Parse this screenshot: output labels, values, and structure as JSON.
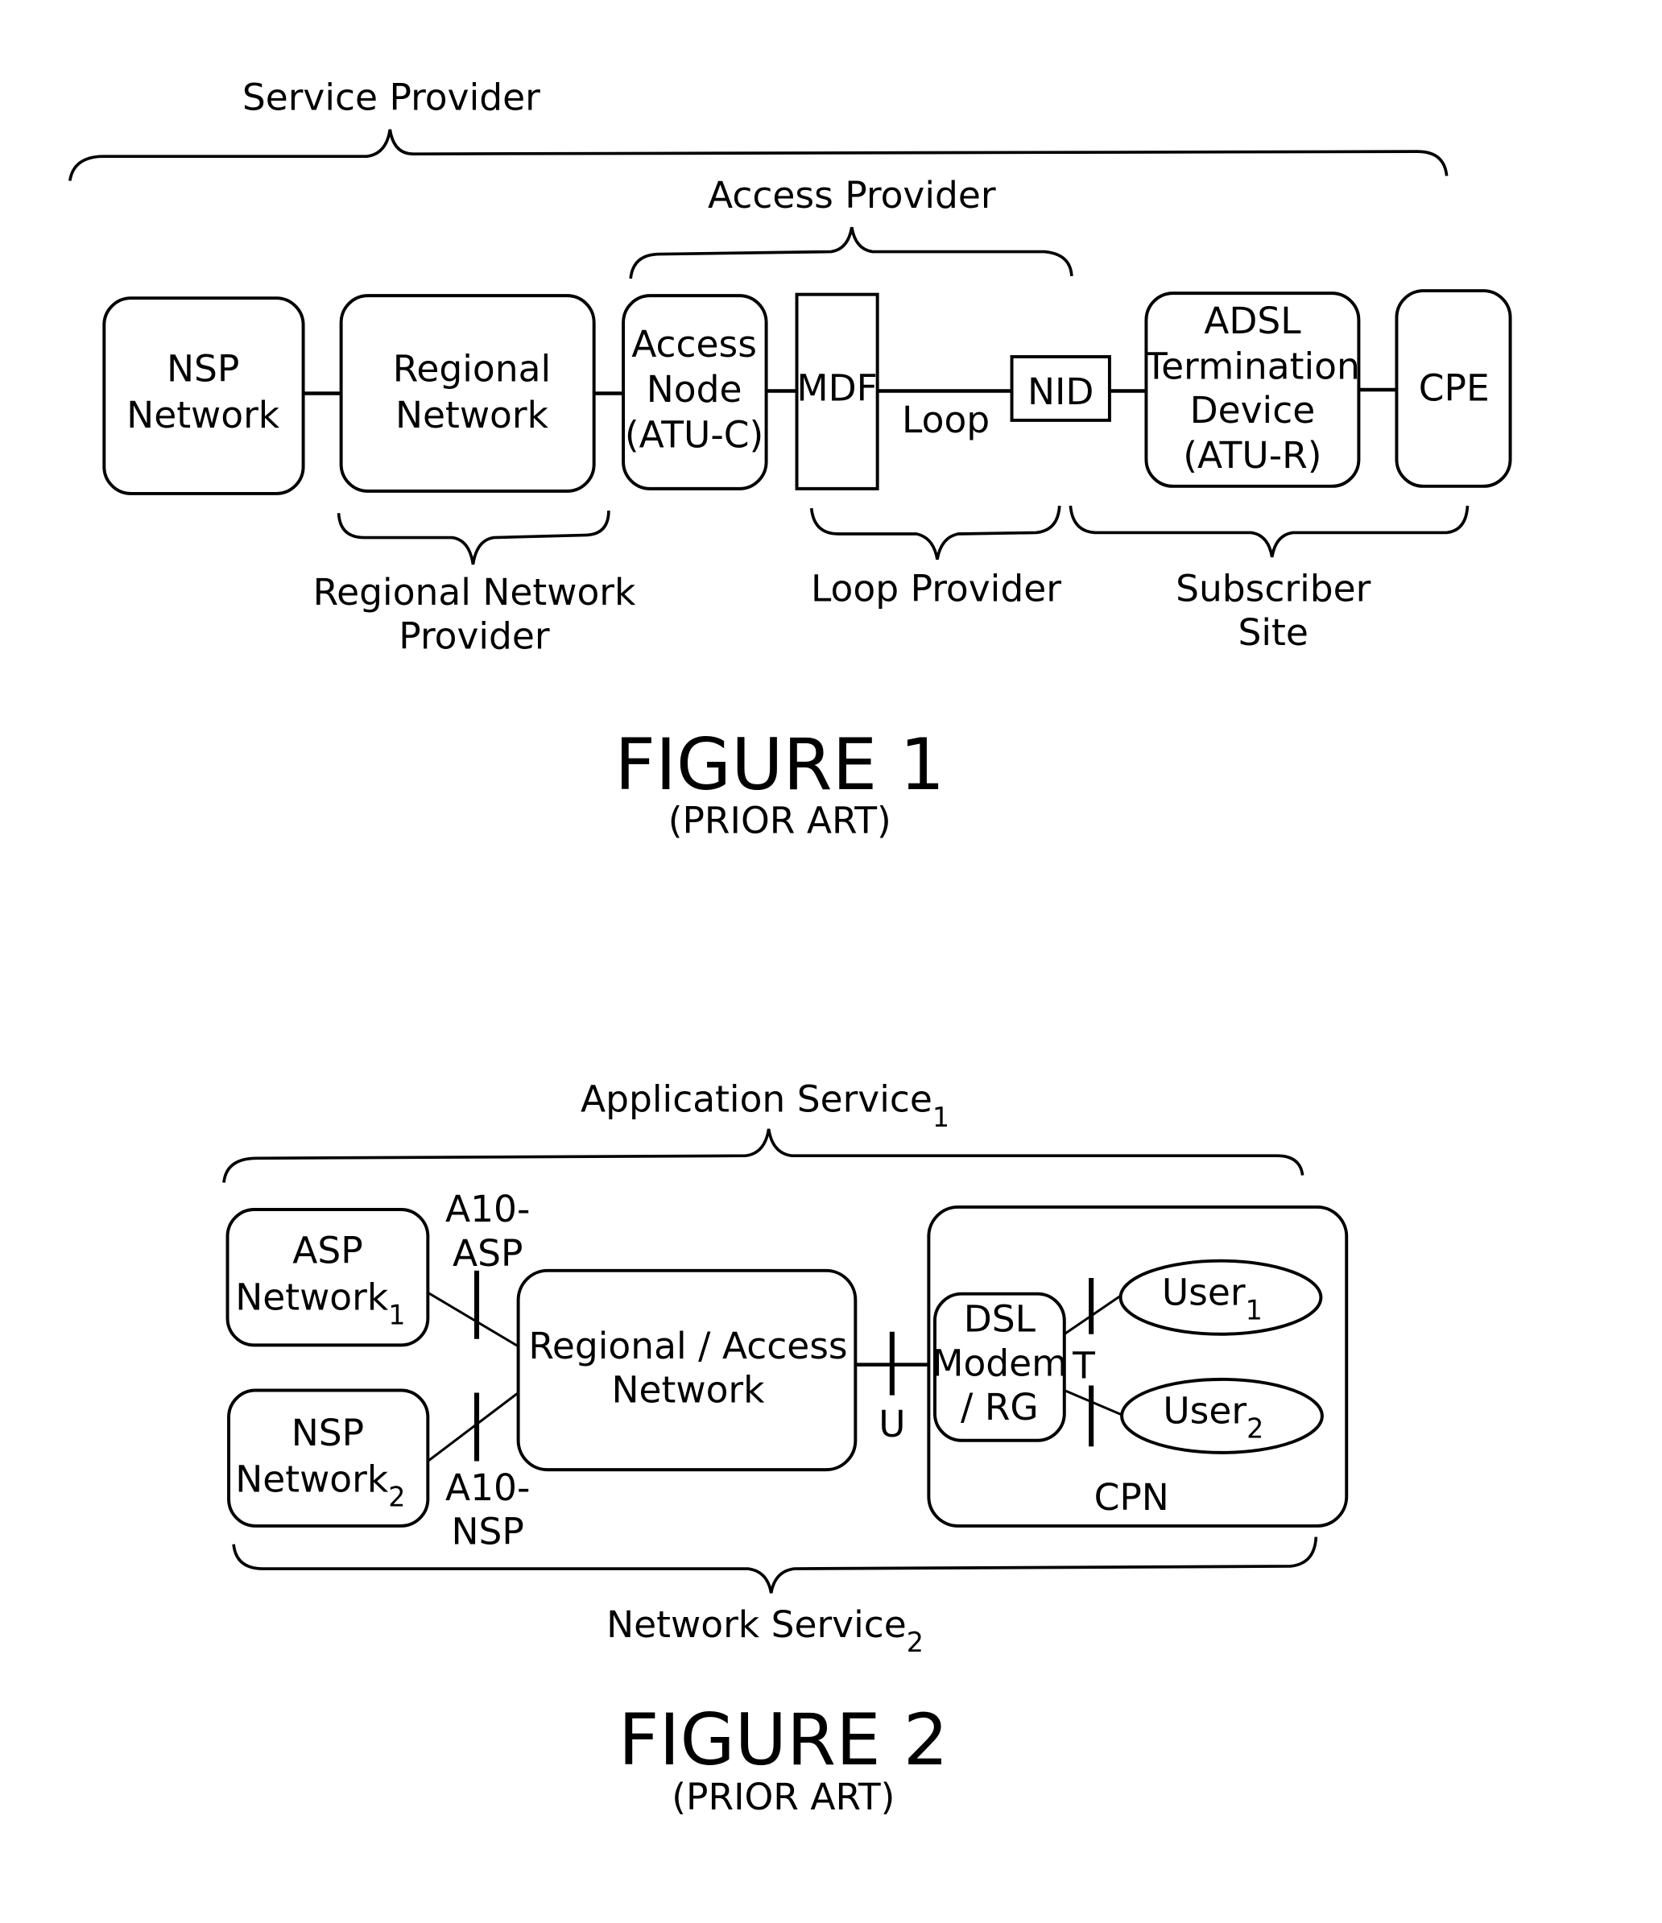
{
  "figure1": {
    "brackets": {
      "service_provider": "Service Provider",
      "access_provider": "Access Provider",
      "regional_network_provider": [
        "Regional Network",
        "Provider"
      ],
      "loop_provider": "Loop Provider",
      "subscriber_site": [
        "Subscriber",
        "Site"
      ]
    },
    "boxes": {
      "nsp_network": [
        "NSP",
        "Network"
      ],
      "regional_network": [
        "Regional",
        "Network"
      ],
      "access_node": [
        "Access",
        "Node",
        "(ATU-C)"
      ],
      "mdf": "MDF",
      "nid": "NID",
      "adsl_termination": [
        "ADSL",
        "Termination",
        "Device",
        "(ATU-R)"
      ],
      "cpe": "CPE"
    },
    "loop_label": "Loop",
    "caption": "FIGURE 1",
    "caption_sub": "(PRIOR ART)"
  },
  "figure2": {
    "brackets": {
      "application_service": "Application Service",
      "application_service_sub": "1",
      "network_service": "Network Service",
      "network_service_sub": "2"
    },
    "boxes": {
      "asp_network": {
        "line1": "ASP",
        "line2": "Network",
        "sub": "1"
      },
      "nsp_network": {
        "line1": "NSP",
        "line2": "Network",
        "sub": "2"
      },
      "regional_access_network": [
        "Regional / Access",
        "Network"
      ],
      "dsl_modem": [
        "DSL",
        "Modem",
        "/ RG"
      ],
      "cpn": "CPN",
      "user1": {
        "label": "User",
        "sub": "1"
      },
      "user2": {
        "label": "User",
        "sub": "2"
      }
    },
    "interfaces": {
      "a10_asp": [
        "A10-",
        "ASP"
      ],
      "a10_nsp": [
        "A10-",
        "NSP"
      ],
      "u": "U",
      "t": "T"
    },
    "caption": "FIGURE 2",
    "caption_sub": "(PRIOR ART)"
  }
}
